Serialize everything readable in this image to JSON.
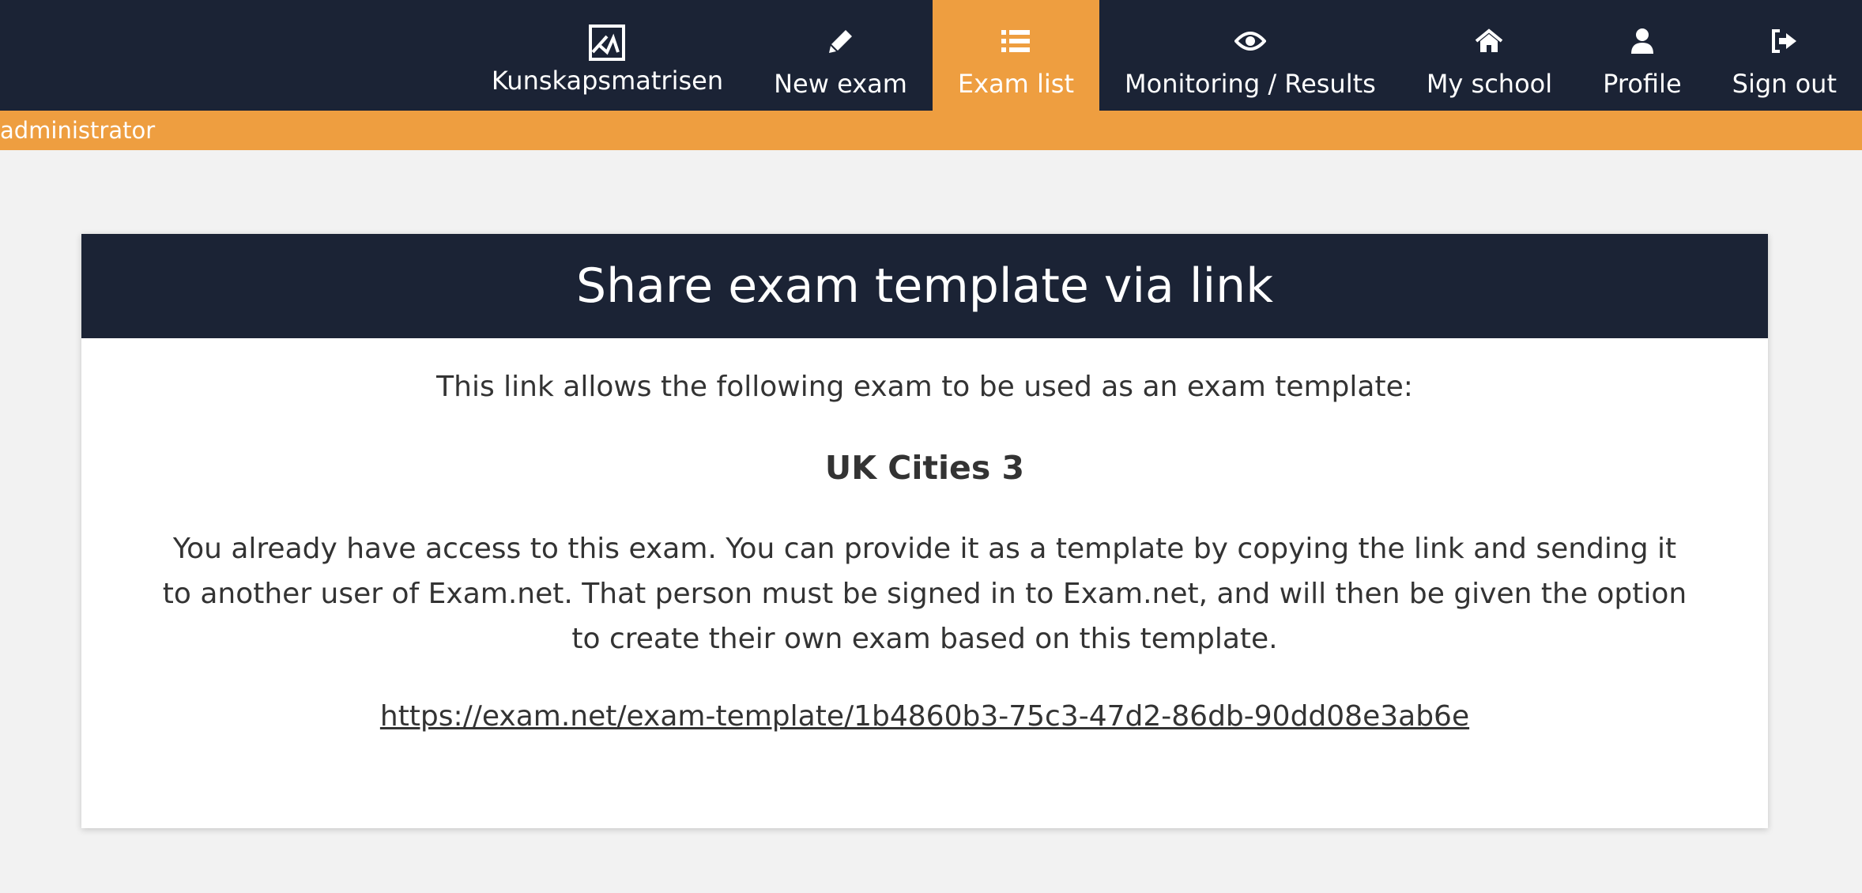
{
  "nav": {
    "items": [
      {
        "label": "Kunskapsmatrisen",
        "icon": "kunskapsmatrisen-logo-icon"
      },
      {
        "label": "New exam",
        "icon": "pencil-icon"
      },
      {
        "label": "Exam list",
        "icon": "list-icon",
        "active": true
      },
      {
        "label": "Monitoring / Results",
        "icon": "eye-icon"
      },
      {
        "label": "My school",
        "icon": "home-icon"
      },
      {
        "label": "Profile",
        "icon": "user-icon"
      },
      {
        "label": "Sign out",
        "icon": "sign-out-icon"
      }
    ]
  },
  "role_bar": {
    "text": "administrator"
  },
  "card": {
    "title": "Share exam template via link",
    "intro": "This link allows the following exam to be used as an exam template:",
    "exam_name": "UK Cities 3",
    "description": "You already have access to this exam. You can provide it as a template by copying the link and sending it to another user of Exam.net. That person must be signed in to Exam.net, and will then be given the option to create their own exam based on this template.",
    "link": "https://exam.net/exam-template/1b4860b3-75c3-47d2-86db-90dd08e3ab6e"
  },
  "colors": {
    "navy": "#1b2335",
    "accent": "#ee9e40",
    "background": "#f2f2f2",
    "text": "#333333"
  }
}
